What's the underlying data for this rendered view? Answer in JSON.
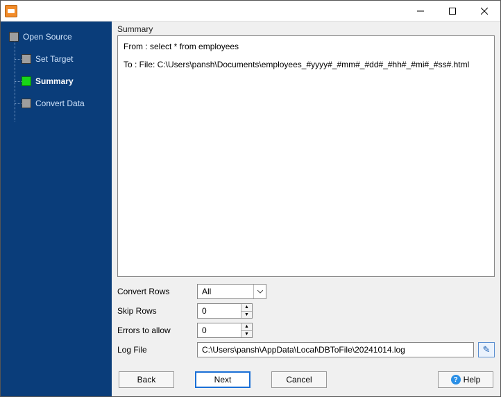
{
  "sidebar": {
    "items": [
      {
        "label": "Open Source"
      },
      {
        "label": "Set Target"
      },
      {
        "label": "Summary"
      },
      {
        "label": "Convert Data"
      }
    ],
    "activeIndex": 2
  },
  "main": {
    "groupLabel": "Summary",
    "summary": {
      "fromLine": "From : select * from employees",
      "toLine": "To : File: C:\\Users\\pansh\\Documents\\employees_#yyyy#_#mm#_#dd#_#hh#_#mi#_#ss#.html"
    },
    "form": {
      "convertRows": {
        "label": "Convert Rows",
        "value": "All"
      },
      "skipRows": {
        "label": "Skip Rows",
        "value": "0"
      },
      "errorsAllow": {
        "label": "Errors to allow",
        "value": "0"
      },
      "logFile": {
        "label": "Log File",
        "value": "C:\\Users\\pansh\\AppData\\Local\\DBToFile\\20241014.log"
      }
    }
  },
  "buttons": {
    "back": "Back",
    "next": "Next",
    "cancel": "Cancel",
    "help": "Help"
  }
}
